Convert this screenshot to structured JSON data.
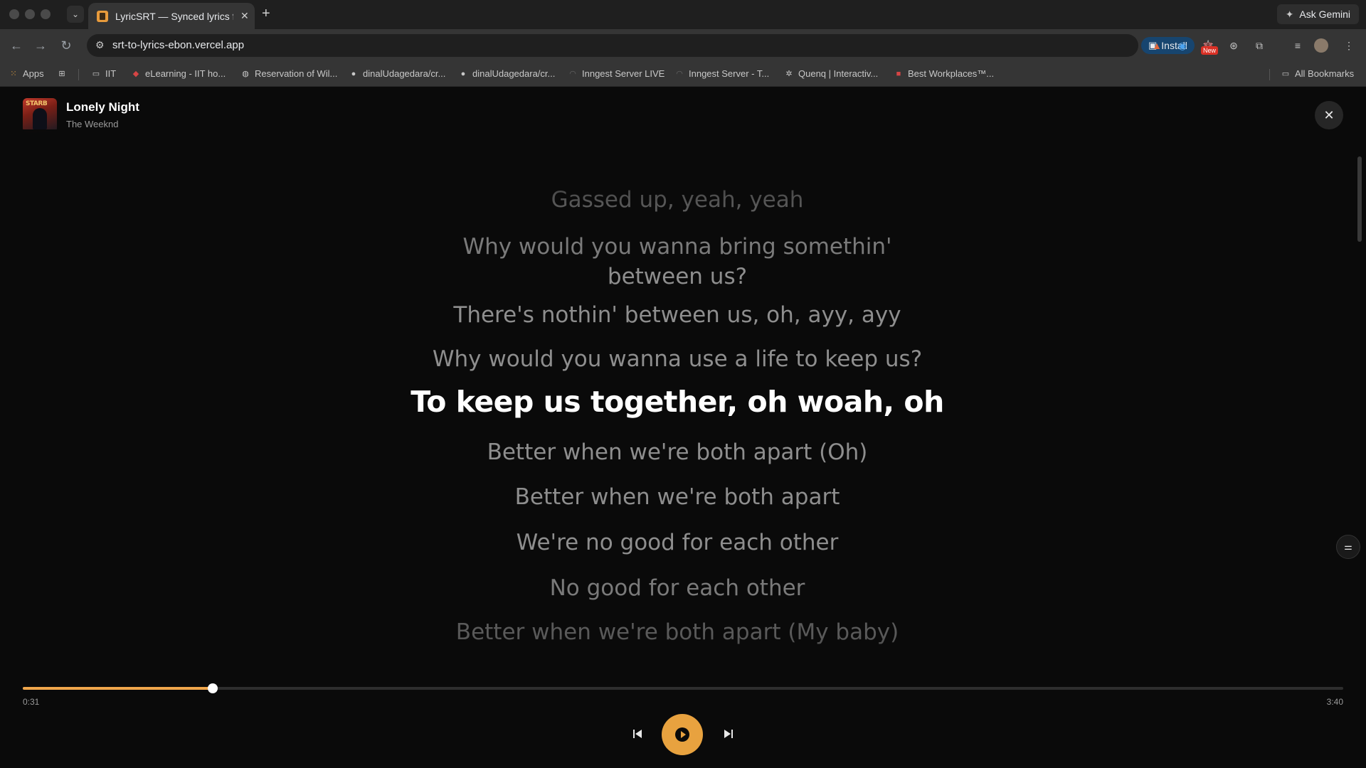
{
  "browser": {
    "tab_title": "LyricSRT — Synced lyrics from",
    "ask_gemini": "Ask Gemini",
    "url": "srt-to-lyrics-ebon.vercel.app",
    "install_label": "Install",
    "new_badge": "New",
    "bookmarks": [
      {
        "label": "Apps",
        "icon": "apps-grid-icon"
      },
      {
        "label": "IIT",
        "icon": "folder-icon"
      },
      {
        "label": "eLearning - IIT ho...",
        "icon": "shield-icon"
      },
      {
        "label": "Reservation of Wil...",
        "icon": "globe-icon"
      },
      {
        "label": "dinalUdagedara/cr...",
        "icon": "github-icon"
      },
      {
        "label": "dinalUdagedara/cr...",
        "icon": "github-icon"
      },
      {
        "label": "Inngest Server LIVE",
        "icon": "inngest-icon"
      },
      {
        "label": "Inngest Server - T...",
        "icon": "inngest-icon"
      },
      {
        "label": "Quenq | Interactiv...",
        "icon": "quenq-icon"
      },
      {
        "label": "Best Workplaces™...",
        "icon": "red-square-icon"
      }
    ],
    "all_bookmarks": "All Bookmarks"
  },
  "player": {
    "title": "Lonely Night",
    "artist": "The Weeknd",
    "lyrics": [
      {
        "text": "Gassed up, yeah, yeah",
        "active": false
      },
      {
        "text": "Why would you wanna bring somethin'",
        "active": false
      },
      {
        "text": "between us?",
        "active": false
      },
      {
        "text": "There's nothin' between us, oh, ayy, ayy",
        "active": false
      },
      {
        "text": "Why would you wanna use a life to keep us?",
        "active": false
      },
      {
        "text": "To keep us together, oh woah, oh",
        "active": true
      },
      {
        "text": "Better when we're both apart (Oh)",
        "active": false
      },
      {
        "text": "Better when we're both apart",
        "active": false
      },
      {
        "text": "We're no good for each other",
        "active": false
      },
      {
        "text": "No good for each other",
        "active": false
      },
      {
        "text": "Better when we're both apart (My baby)",
        "active": false
      }
    ],
    "current_time": "0:31",
    "total_time": "3:40",
    "progress": 0.1436,
    "accent_color": "#e8a23f"
  }
}
